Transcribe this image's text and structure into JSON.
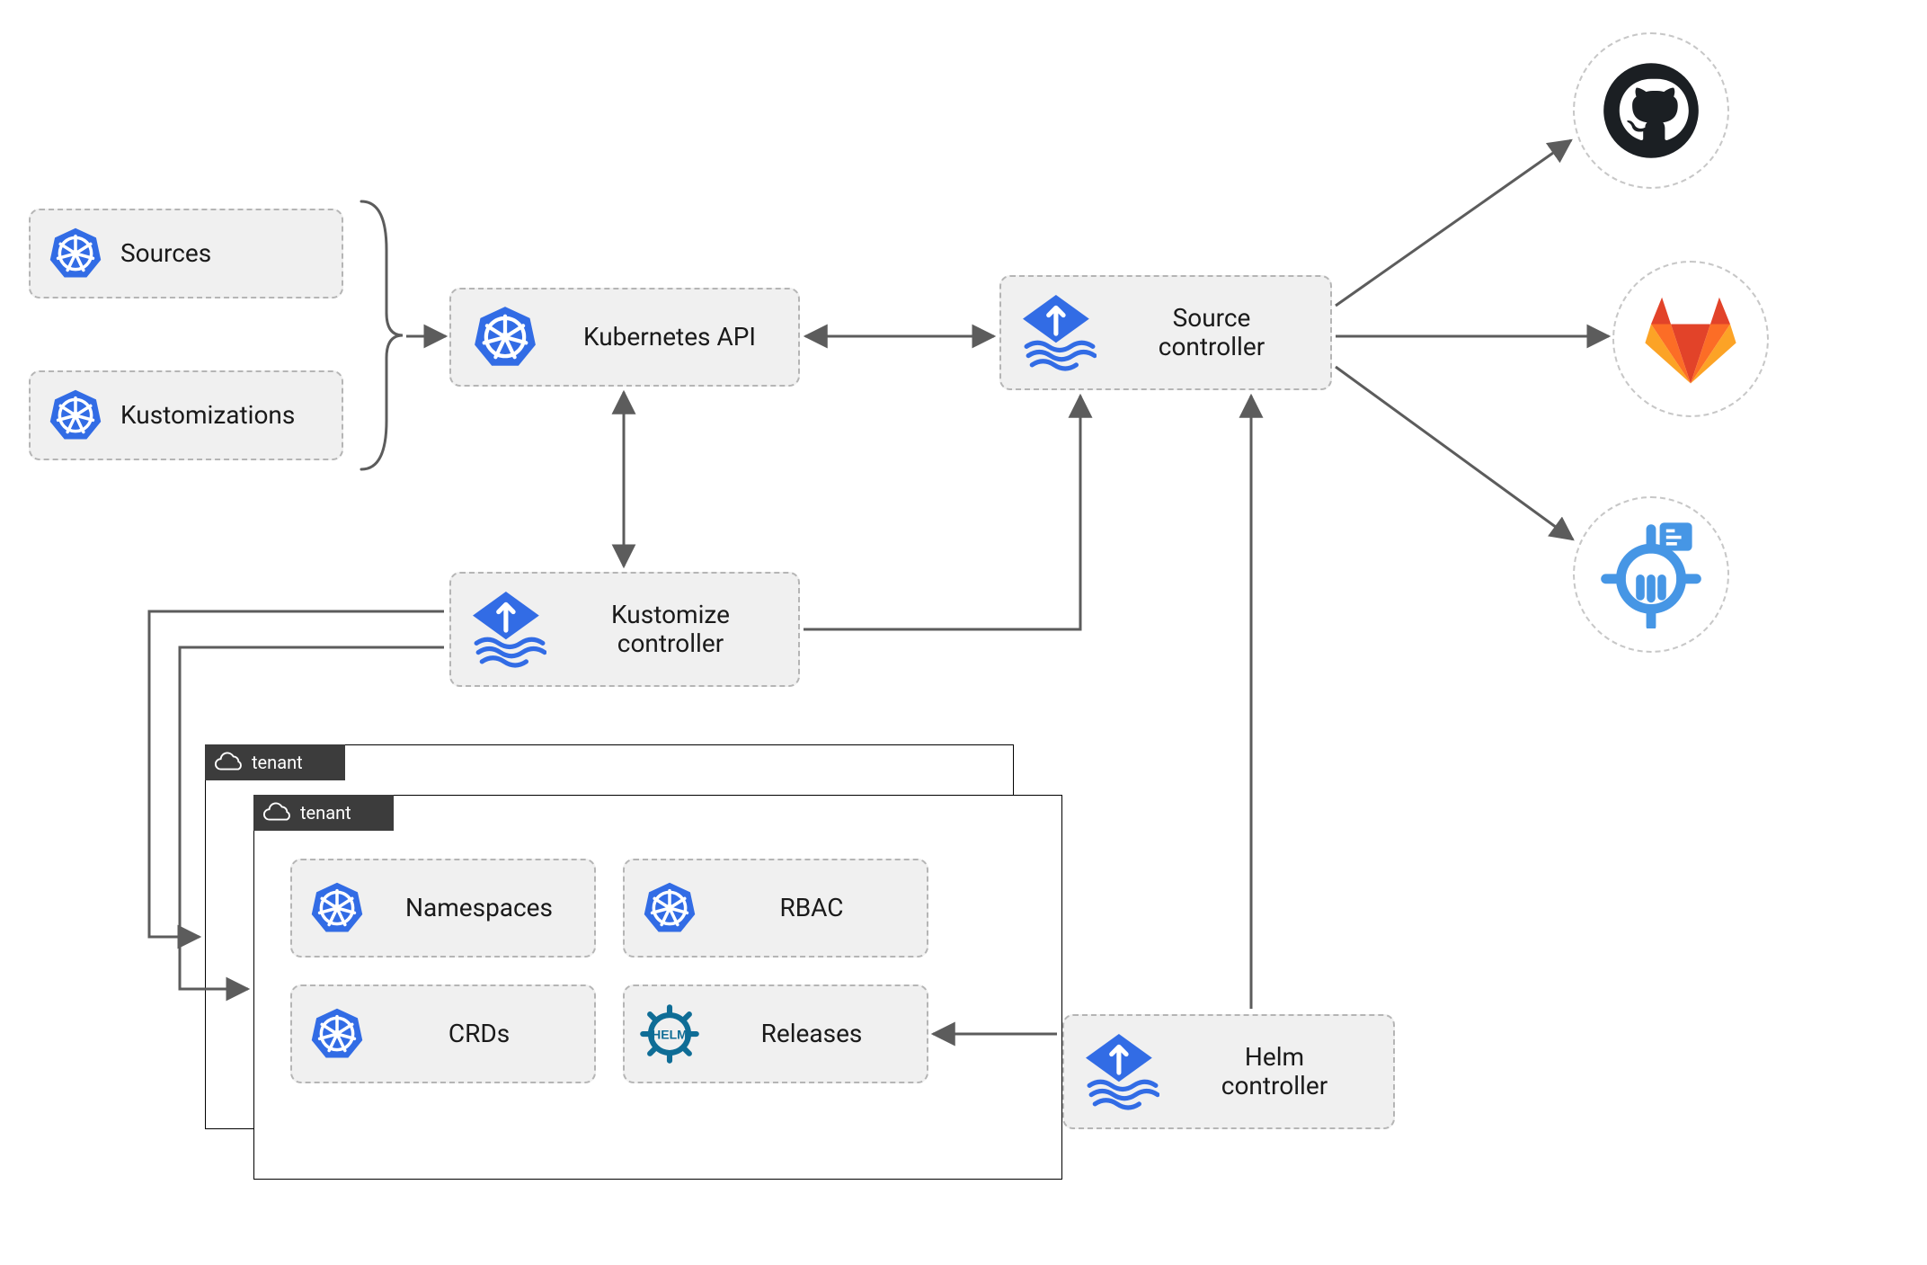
{
  "boxes": {
    "sources": {
      "label": "Sources",
      "icon": "kubernetes"
    },
    "kustomizations": {
      "label": "Kustomizations",
      "icon": "kubernetes"
    },
    "kubernetes_api": {
      "label": "Kubernetes API",
      "icon": "kubernetes"
    },
    "source_ctrl": {
      "label": "Source\ncontroller",
      "icon": "flux"
    },
    "kustomize_ctrl": {
      "label": "Kustomize\ncontroller",
      "icon": "flux"
    },
    "helm_ctrl": {
      "label": "Helm\ncontroller",
      "icon": "flux"
    },
    "namespaces": {
      "label": "Namespaces",
      "icon": "kubernetes"
    },
    "rbac": {
      "label": "RBAC",
      "icon": "kubernetes"
    },
    "crds": {
      "label": "CRDs",
      "icon": "kubernetes"
    },
    "releases": {
      "label": "Releases",
      "icon": "helm"
    }
  },
  "tenant_label": "tenant",
  "providers": {
    "github": "github",
    "gitlab": "gitlab",
    "harbor": "harbor"
  },
  "colors": {
    "k8s_blue": "#326CE5",
    "flux_blue": "#326CE5",
    "helm_teal": "#0F6D96",
    "gitlab_orange": "#FC6D26",
    "gitlab_orange2": "#E24329",
    "gitlab_yellow": "#FCA326",
    "github_dark": "#1B1F23",
    "harbor_blue": "#4696E5",
    "arrow": "#5c5c5c",
    "box_bg": "#f0f0f0",
    "box_border": "#b5b5b5"
  },
  "arrows": [
    {
      "name": "k8s-api<->source-ctrl",
      "type": "double"
    },
    {
      "name": "k8s-api<->kustomize-ctrl",
      "type": "double"
    },
    {
      "name": "kustomize-ctrl->source-ctrl",
      "type": "single"
    },
    {
      "name": "helm-ctrl->source-ctrl",
      "type": "single"
    },
    {
      "name": "kustomize-ctrl->tenant1",
      "type": "single"
    },
    {
      "name": "kustomize-ctrl->tenant2",
      "type": "single"
    },
    {
      "name": "helm-ctrl->releases",
      "type": "single"
    },
    {
      "name": "source-ctrl->github",
      "type": "single"
    },
    {
      "name": "source-ctrl->gitlab",
      "type": "single"
    },
    {
      "name": "source-ctrl->harbor",
      "type": "single"
    },
    {
      "name": "brace->k8s-api",
      "type": "single"
    }
  ]
}
